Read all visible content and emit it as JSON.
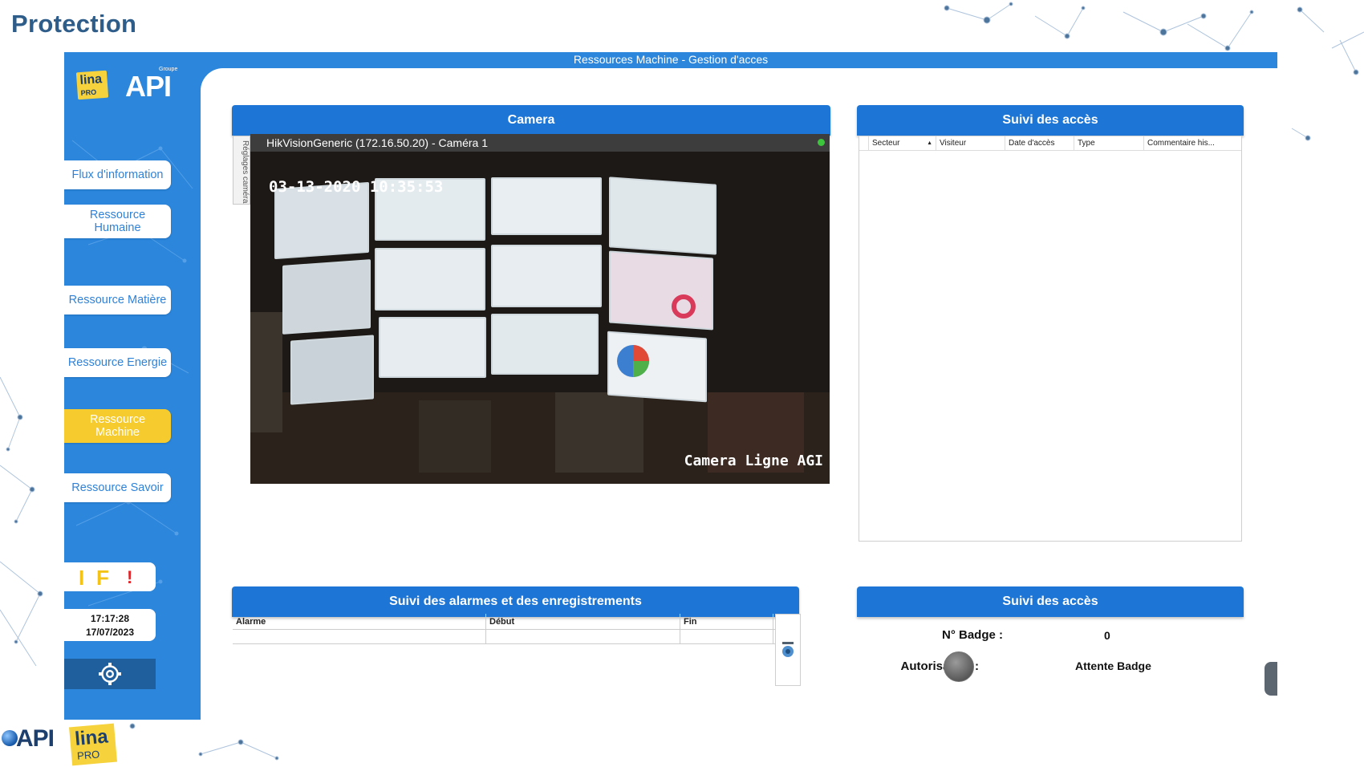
{
  "page": {
    "title": "Protection"
  },
  "window": {
    "title": "Ressources Machine - Gestion d'acces"
  },
  "logos": {
    "lina": "lina",
    "pro": "PRO",
    "api": "API",
    "api_sub": "Groupe"
  },
  "sidebar": {
    "items": [
      {
        "label": "Flux d'information",
        "active": false
      },
      {
        "label": "Ressource Humaine",
        "active": false
      },
      {
        "label": "Ressource Matière",
        "active": false
      },
      {
        "label": "Ressource Energie",
        "active": false
      },
      {
        "label": "Ressource Machine",
        "active": true
      },
      {
        "label": "Ressource Savoir",
        "active": false
      }
    ],
    "status_icons": {
      "i": "I",
      "f": "F",
      "alert": "!"
    },
    "clock": {
      "time": "17:17:28",
      "date": "17/07/2023"
    },
    "settings_icon": "gear-icon"
  },
  "camera": {
    "header": "Camera",
    "settings_tab": "Réglages caméra",
    "source": "HikVisionGeneric (172.16.50.20) - Caméra 1",
    "timestamp": "03-13-2020 10:35:53",
    "overlay_label": "Camera Ligne AGI"
  },
  "access_log": {
    "header": "Suivi des accès",
    "columns": [
      "Secteur",
      "Visiteur",
      "Date d'accès",
      "Type",
      "Commentaire his..."
    ],
    "rows": []
  },
  "alarms": {
    "header": "Suivi des alarmes et des enregistrements",
    "columns": [
      "Alarme",
      "Début",
      "Fin"
    ],
    "rows": []
  },
  "badge": {
    "header": "Suivi des accès",
    "badge_label": "N° Badge :",
    "badge_value": "0",
    "auth_label": "Autorisation :",
    "auth_status": "Attente Badge"
  },
  "colors": {
    "app_blue": "#2b86dc",
    "header_blue": "#1d76d5",
    "active_yellow": "#f6cb2e",
    "nav_text": "#2f82d8"
  }
}
